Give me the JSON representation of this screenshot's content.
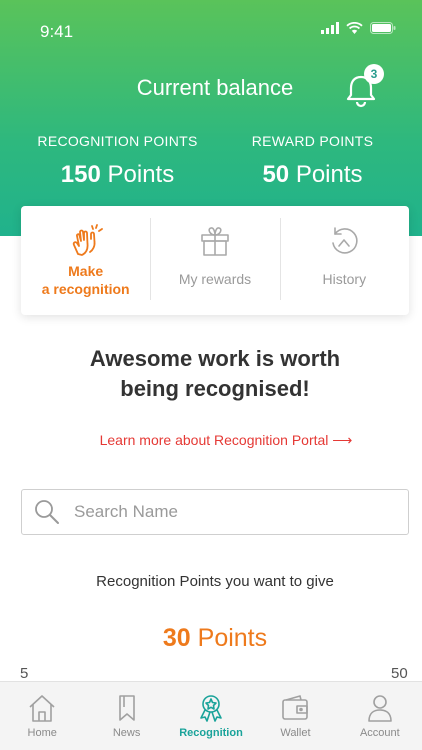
{
  "status_bar": {
    "time": "9:41"
  },
  "header": {
    "title": "Current balance",
    "notification_count": "3",
    "recognition": {
      "label": "RECOGNITION POINTS",
      "number": "150",
      "unit": "Points"
    },
    "reward": {
      "label": "REWARD POINTS",
      "number": "50",
      "unit": "Points"
    }
  },
  "actions": {
    "make_line1": "Make",
    "make_line2": "a recognition",
    "rewards": "My rewards",
    "history": "History"
  },
  "main": {
    "headline_line1": "Awesome work is worth",
    "headline_line2": "being recognised!",
    "learn_more": "Learn more about Recognition Portal ⟶",
    "search_placeholder": "Search Name",
    "give_label": "Recognition Points you want to give",
    "give_number": "30",
    "give_unit": "Points",
    "range_min": "5",
    "range_max": "50"
  },
  "tabs": [
    {
      "label": "Home",
      "icon": "home-icon"
    },
    {
      "label": "News",
      "icon": "bookmark-icon"
    },
    {
      "label": "Recognition",
      "icon": "award-icon"
    },
    {
      "label": "Wallet",
      "icon": "wallet-icon"
    },
    {
      "label": "Account",
      "icon": "user-icon"
    }
  ],
  "colors": {
    "accent_orange": "#ee7a1c",
    "accent_teal": "#1aa39a",
    "link_red": "#e53935",
    "header_green": "#5ac35a"
  }
}
